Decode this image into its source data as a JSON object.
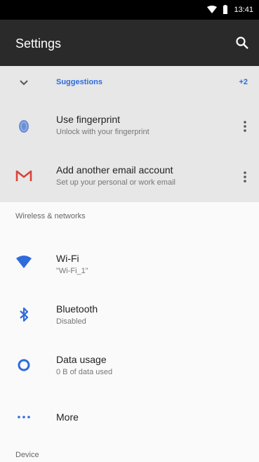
{
  "status_bar": {
    "time": "13:41",
    "icons": [
      "wifi-icon",
      "battery-icon"
    ]
  },
  "app_bar": {
    "title": "Settings",
    "search_icon": "search-icon"
  },
  "suggestions": {
    "header_label": "Suggestions",
    "count_label": "+2",
    "items": [
      {
        "title": "Use fingerprint",
        "subtitle": "Unlock with your fingerprint",
        "icon": "fingerprint-icon"
      },
      {
        "title": "Add another email account",
        "subtitle": "Set up your personal or work email",
        "icon": "gmail-icon"
      }
    ]
  },
  "sections": {
    "wireless_title": "Wireless & networks",
    "device_title": "Device"
  },
  "wireless_items": [
    {
      "title": "Wi-Fi",
      "subtitle": "\"Wi-Fi_1\"",
      "icon": "wifi-icon"
    },
    {
      "title": "Bluetooth",
      "subtitle": "Disabled",
      "icon": "bluetooth-icon"
    },
    {
      "title": "Data usage",
      "subtitle": "0 B of data used",
      "icon": "data-usage-icon"
    },
    {
      "title": "More",
      "subtitle": "",
      "icon": "more-dots-icon"
    }
  ],
  "colors": {
    "accent": "#2f6bdc",
    "status_bar": "#000000",
    "app_bar": "#2a2a2a",
    "suggestions_bg": "#e7e7e7"
  }
}
